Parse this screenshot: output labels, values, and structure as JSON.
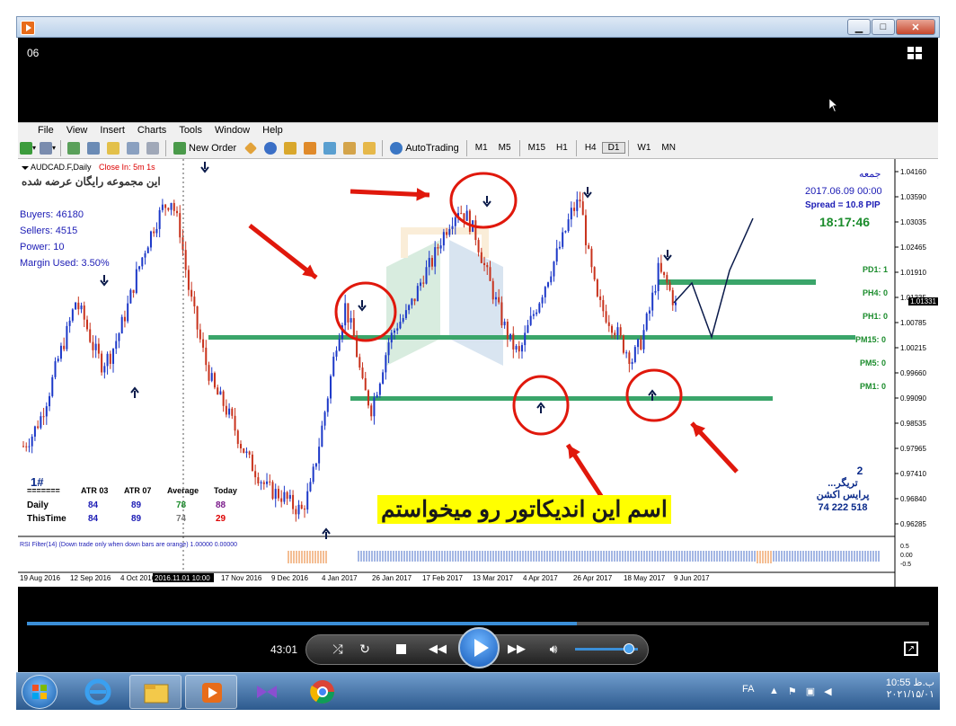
{
  "player": {
    "window_controls": {
      "minimize": "▁",
      "maximize": "□",
      "close": "✕"
    },
    "video_label": "06",
    "time_current": "43:01",
    "seek_fraction": 0.61,
    "volume_fraction": 0.85
  },
  "mt4": {
    "menu": [
      "File",
      "View",
      "Insert",
      "Charts",
      "Tools",
      "Window",
      "Help"
    ],
    "toolbar": {
      "new_order": "New Order",
      "autotrading": "AutoTrading",
      "timeframes": [
        "M1",
        "M5",
        "M15",
        "H1",
        "H4",
        "D1",
        "W1",
        "MN"
      ],
      "selected_timeframe": "D1"
    },
    "symbol": "AUDCAD.F,Daily",
    "close_in": "Close In: 5m 1s",
    "free_text": "این مجموعه رایگان عرضه شده",
    "stats": [
      "Buyers: 46180",
      "Sellers: 4515",
      "Power: 10",
      "Margin Used: 3.50%"
    ],
    "day_name": "جمعه",
    "date_time": "2017.06.09 00:00",
    "spread": "Spread = 10.8  PIP",
    "clock": "18:17:46",
    "pivots": [
      "PD1: 1",
      "PH4: 0",
      "PH1: 0",
      "PM15: 0",
      "PM5: 0",
      "PM1: 0"
    ],
    "price_box": "1.01331",
    "atr_table": {
      "header": [
        "=======",
        "ATR 03",
        "ATR 07",
        "Average",
        "Today"
      ],
      "rows": [
        [
          "Daily",
          "84",
          "89",
          "78",
          "88"
        ],
        [
          "ThisTime",
          "84",
          "89",
          "74",
          "29"
        ]
      ]
    },
    "ea_number": "1#",
    "right_panel": {
      "count": "2",
      "line1": "...تریگر",
      "line2": "پرایس اکشن",
      "numbers": "74  222  518"
    },
    "annotation": "اسم این اندیکاتور رو میخواستم",
    "rsi_label": "RSI Filter(14) (Down trade only when down bars are orange) 1.00000 0.00000"
  },
  "chart_data": {
    "type": "candlestick",
    "symbol": "AUDCAD.F,Daily",
    "y_ticks": [
      "1.04160",
      "1.03590",
      "1.03035",
      "1.02465",
      "1.01910",
      "1.01335",
      "1.00785",
      "1.00215",
      "0.99660",
      "0.99090",
      "0.98535",
      "0.97965",
      "0.97410",
      "0.96840",
      "0.96285"
    ],
    "x_ticks": [
      "19 Aug 2016",
      "12 Sep 2016",
      "4 Oct 2016",
      "2016.11.01 10:00",
      "17 Nov 2016",
      "9 Dec 2016",
      "4 Jan 2017",
      "26 Jan 2017",
      "17 Feb 2017",
      "13 Mar 2017",
      "4 Apr 2017",
      "26 Apr 2017",
      "18 May 2017",
      "9 Jun 2017"
    ],
    "rsi_ticks": [
      "0.5",
      "0.00",
      "-0.5"
    ],
    "ylim": [
      0.96,
      1.0425
    ],
    "close_path": [
      0.9795,
      0.982,
      0.986,
      0.992,
      0.999,
      1.005,
      1.012,
      1.008,
      1.002,
      0.998,
      1.0,
      1.005,
      1.011,
      1.018,
      1.024,
      1.029,
      1.033,
      1.035,
      1.028,
      1.015,
      1.006,
      0.998,
      0.992,
      0.989,
      0.985,
      0.98,
      0.976,
      0.973,
      0.97,
      0.969,
      0.968,
      0.966,
      0.965,
      0.97,
      0.98,
      0.991,
      1.003,
      1.011,
      1.004,
      0.993,
      0.988,
      0.995,
      1.003,
      1.007,
      1.009,
      1.013,
      1.018,
      1.021,
      1.026,
      1.03,
      1.033,
      1.031,
      1.027,
      1.02,
      1.014,
      1.008,
      1.003,
      1.0,
      1.006,
      1.011,
      1.016,
      1.021,
      1.026,
      1.032,
      1.035,
      1.022,
      1.012,
      1.009,
      1.006,
      1.002,
      0.999,
      1.003,
      1.01,
      1.019,
      1.016,
      1.011
    ]
  }
}
